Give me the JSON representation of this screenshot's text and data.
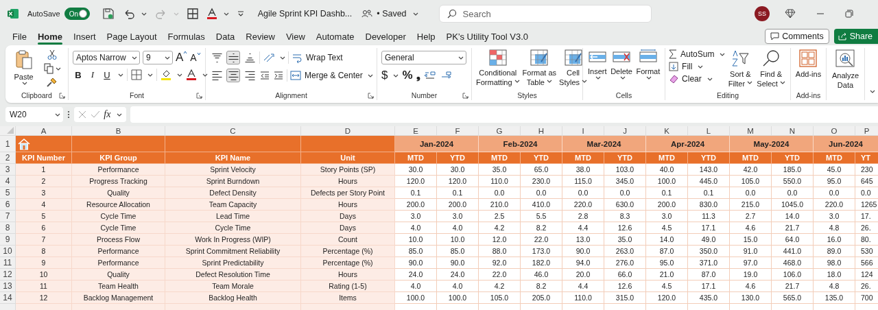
{
  "title_bar": {
    "autosave_label": "AutoSave",
    "autosave": {
      "label": "On",
      "on": true
    },
    "document_title": "Agile Sprint KPI Dashb...",
    "save_status": "• Saved",
    "search": {
      "placeholder": "Search"
    },
    "avatar": "SS"
  },
  "menu_tabs": [
    {
      "label": "File",
      "selected": false
    },
    {
      "label": "Home",
      "selected": true
    },
    {
      "label": "Insert",
      "selected": false
    },
    {
      "label": "Page Layout",
      "selected": false
    },
    {
      "label": "Formulas",
      "selected": false
    },
    {
      "label": "Data",
      "selected": false
    },
    {
      "label": "Review",
      "selected": false
    },
    {
      "label": "View",
      "selected": false
    },
    {
      "label": "Automate",
      "selected": false
    },
    {
      "label": "Developer",
      "selected": false
    },
    {
      "label": "Help",
      "selected": false
    },
    {
      "label": "PK’s Utility Tool V3.0",
      "selected": false
    }
  ],
  "comments_button": "Comments",
  "share_button": "Share",
  "ribbon": {
    "clipboard": {
      "label": "Clipboard",
      "paste": "Paste"
    },
    "font": {
      "label": "Font",
      "font_name": "Aptos Narrow",
      "font_size": "9",
      "grow_font": "A",
      "shrink_font": "A",
      "format_buttons": [
        {
          "kind": "bold",
          "label": "B"
        },
        {
          "kind": "italic",
          "label": "I"
        },
        {
          "kind": "underline",
          "label": "U"
        }
      ]
    },
    "alignment": {
      "label": "Alignment",
      "vertical": [
        {
          "kind": "top",
          "selected": false
        },
        {
          "kind": "middle",
          "selected": true
        },
        {
          "kind": "bottom",
          "selected": false
        }
      ],
      "horizontal": [
        {
          "kind": "left",
          "selected": false
        },
        {
          "kind": "center",
          "selected": true
        },
        {
          "kind": "right",
          "selected": false
        }
      ],
      "wrap_text": "Wrap Text",
      "merge_center": "Merge & Center"
    },
    "number": {
      "label": "Number",
      "format": "General",
      "symbols": [
        {
          "kind": "currency",
          "label": "$"
        },
        {
          "kind": "percent",
          "label": "%"
        },
        {
          "kind": "comma",
          "label": "❟"
        }
      ]
    },
    "styles": {
      "label": "Styles",
      "buttons": [
        {
          "kind": "conditional",
          "lines": [
            "Conditional",
            "Formatting"
          ]
        },
        {
          "kind": "table",
          "lines": [
            "Format as",
            "Table"
          ]
        },
        {
          "kind": "cell_styles",
          "lines": [
            "Cell",
            "Styles"
          ]
        }
      ]
    },
    "cells": {
      "label": "Cells",
      "buttons": [
        {
          "kind": "insert",
          "label": "Insert"
        },
        {
          "kind": "delete",
          "label": "Delete"
        },
        {
          "kind": "format",
          "label": "Format"
        }
      ]
    },
    "editing": {
      "label": "Editing",
      "autosum": "AutoSum",
      "fill": "Fill",
      "clear": "Clear",
      "sort_filter": [
        "Sort &",
        "Filter"
      ],
      "find_select": [
        "Find &",
        "Select"
      ]
    },
    "addins": {
      "label": "Add-ins",
      "button": "Add-ins"
    },
    "analyze": {
      "lines": [
        "Analyze",
        "Data"
      ]
    }
  },
  "formula_bar": {
    "name_box": "W20",
    "function_label": "fx"
  },
  "sheet": {
    "column_letters": [
      "A",
      "B",
      "C",
      "D",
      "E",
      "F",
      "G",
      "H",
      "I",
      "J",
      "K",
      "L",
      "M",
      "N",
      "O",
      "P"
    ],
    "month_row": {
      "row_number": "1",
      "months": [
        "Jan-2024",
        "Feb-2024",
        "Mar-2024",
        "Apr-2024",
        "May-2024",
        "Jun-2024"
      ]
    },
    "header_row": {
      "row_number": "2",
      "headers": [
        "KPI Number",
        "KPI Group",
        "KPI Name",
        "Unit"
      ],
      "periods": [
        "MTD",
        "YTD",
        "MTD",
        "YTD",
        "MTD",
        "YTD",
        "MTD",
        "YTD",
        "MTD",
        "YTD",
        "MTD",
        "YT"
      ]
    },
    "rows": [
      {
        "row_number": "3",
        "cells": [
          "1",
          "Performance",
          "Sprint Velocity",
          "Story Points (SP)"
        ],
        "values": [
          "30.0",
          "30.0",
          "35.0",
          "65.0",
          "38.0",
          "103.0",
          "40.0",
          "143.0",
          "42.0",
          "185.0",
          "45.0",
          "230"
        ]
      },
      {
        "row_number": "4",
        "cells": [
          "2",
          "Progress Tracking",
          "Sprint Burndown",
          "Hours"
        ],
        "values": [
          "120.0",
          "120.0",
          "110.0",
          "230.0",
          "115.0",
          "345.0",
          "100.0",
          "445.0",
          "105.0",
          "550.0",
          "95.0",
          "645"
        ]
      },
      {
        "row_number": "5",
        "cells": [
          "3",
          "Quality",
          "Defect Density",
          "Defects per Story Point"
        ],
        "values": [
          "0.1",
          "0.1",
          "0.0",
          "0.0",
          "0.0",
          "0.0",
          "0.1",
          "0.1",
          "0.0",
          "0.0",
          "0.0",
          "0.0"
        ]
      },
      {
        "row_number": "6",
        "cells": [
          "4",
          "Resource Allocation",
          "Team Capacity",
          "Hours"
        ],
        "values": [
          "200.0",
          "200.0",
          "210.0",
          "410.0",
          "220.0",
          "630.0",
          "200.0",
          "830.0",
          "215.0",
          "1045.0",
          "220.0",
          "1265"
        ]
      },
      {
        "row_number": "7",
        "cells": [
          "5",
          "Cycle Time",
          "Lead Time",
          "Days"
        ],
        "values": [
          "3.0",
          "3.0",
          "2.5",
          "5.5",
          "2.8",
          "8.3",
          "3.0",
          "11.3",
          "2.7",
          "14.0",
          "3.0",
          "17."
        ]
      },
      {
        "row_number": "8",
        "cells": [
          "6",
          "Cycle Time",
          "Cycle Time",
          "Days"
        ],
        "values": [
          "4.0",
          "4.0",
          "4.2",
          "8.2",
          "4.4",
          "12.6",
          "4.5",
          "17.1",
          "4.6",
          "21.7",
          "4.8",
          "26."
        ]
      },
      {
        "row_number": "9",
        "cells": [
          "7",
          "Process Flow",
          "Work In Progress (WIP)",
          "Count"
        ],
        "values": [
          "10.0",
          "10.0",
          "12.0",
          "22.0",
          "13.0",
          "35.0",
          "14.0",
          "49.0",
          "15.0",
          "64.0",
          "16.0",
          "80."
        ]
      },
      {
        "row_number": "10",
        "cells": [
          "8",
          "Performance",
          "Sprint Commitment Reliability",
          "Percentage (%)"
        ],
        "values": [
          "85.0",
          "85.0",
          "88.0",
          "173.0",
          "90.0",
          "263.0",
          "87.0",
          "350.0",
          "91.0",
          "441.0",
          "89.0",
          "530"
        ]
      },
      {
        "row_number": "11",
        "cells": [
          "9",
          "Performance",
          "Sprint Predictability",
          "Percentage (%)"
        ],
        "values": [
          "90.0",
          "90.0",
          "92.0",
          "182.0",
          "94.0",
          "276.0",
          "95.0",
          "371.0",
          "97.0",
          "468.0",
          "98.0",
          "566"
        ]
      },
      {
        "row_number": "12",
        "cells": [
          "10",
          "Quality",
          "Defect Resolution Time",
          "Hours"
        ],
        "values": [
          "24.0",
          "24.0",
          "22.0",
          "46.0",
          "20.0",
          "66.0",
          "21.0",
          "87.0",
          "19.0",
          "106.0",
          "18.0",
          "124"
        ]
      },
      {
        "row_number": "13",
        "cells": [
          "11",
          "Team Health",
          "Team Morale",
          "Rating (1-5)"
        ],
        "values": [
          "4.0",
          "4.0",
          "4.2",
          "8.2",
          "4.4",
          "12.6",
          "4.5",
          "17.1",
          "4.6",
          "21.7",
          "4.8",
          "26."
        ]
      },
      {
        "row_number": "14",
        "cells": [
          "12",
          "Backlog Management",
          "Backlog Health",
          "Items"
        ],
        "values": [
          "100.0",
          "100.0",
          "105.0",
          "205.0",
          "110.0",
          "315.0",
          "120.0",
          "435.0",
          "130.0",
          "565.0",
          "135.0",
          "700"
        ]
      }
    ]
  }
}
